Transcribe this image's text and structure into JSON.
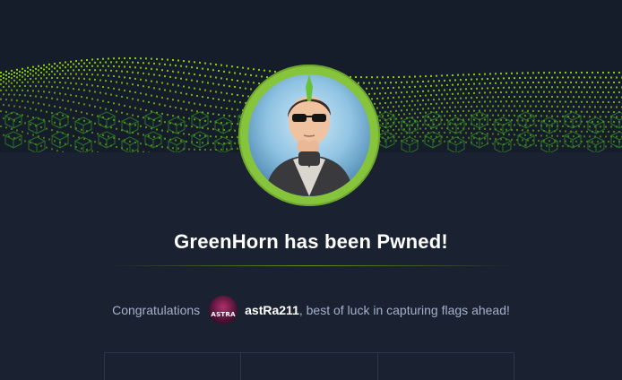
{
  "machine": {
    "name": "GreenHorn",
    "pwned_title": "GreenHorn has been Pwned!"
  },
  "congrats": {
    "prefix": "Congratulations",
    "username": "astRa211",
    "suffix": ", best of luck in capturing flags ahead!",
    "avatar_text": "ASTRA"
  },
  "colors": {
    "background": "#1a2130",
    "accent_green": "#9fef00",
    "avatar_ring": "#86c43c",
    "text_muted": "#a4b1cd",
    "text_white": "#ffffff"
  }
}
